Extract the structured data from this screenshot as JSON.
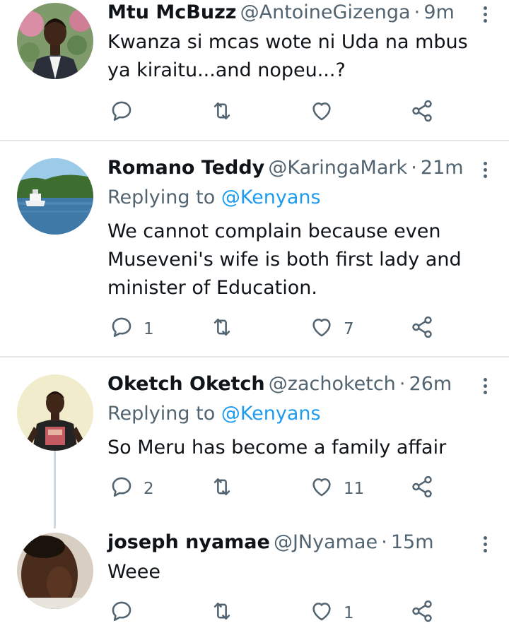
{
  "tweets": [
    {
      "name": "Mtu McBuzz",
      "handle": "@AntoineGizenga",
      "dot": "·",
      "time": "9m",
      "replying_prefix": "",
      "replying_mention": "",
      "body": "Kwanza si mcas wote ni Uda na mbus ya kiraitu...and nopeu...?",
      "reply_count": "",
      "retweet_count": "",
      "like_count": ""
    },
    {
      "name": "Romano Teddy",
      "handle": "@KaringaMark",
      "dot": "·",
      "time": "21m",
      "replying_prefix": "Replying to",
      "replying_mention": "@Kenyans",
      "body": "We cannot complain because even Museveni's wife is both first lady and minister of Education.",
      "reply_count": "1",
      "retweet_count": "",
      "like_count": "7"
    },
    {
      "name": "Oketch Oketch",
      "handle": "@zachoketch",
      "dot": "·",
      "time": "26m",
      "replying_prefix": "Replying to",
      "replying_mention": "@Kenyans",
      "body": "So Meru has become a family affair",
      "reply_count": "2",
      "retweet_count": "",
      "like_count": "11"
    },
    {
      "name": "joseph nyamae",
      "handle": "@JNyamae",
      "dot": "·",
      "time": "15m",
      "replying_prefix": "",
      "replying_mention": "",
      "body": "Weee",
      "reply_count": "",
      "retweet_count": "",
      "like_count": "1"
    }
  ],
  "colors": {
    "text": "#0f1419",
    "muted": "#536471",
    "link": "#1d9bf0",
    "divider": "#e3e6e8"
  },
  "icons": [
    "reply-icon",
    "retweet-icon",
    "like-icon",
    "share-icon",
    "more-options-icon"
  ]
}
